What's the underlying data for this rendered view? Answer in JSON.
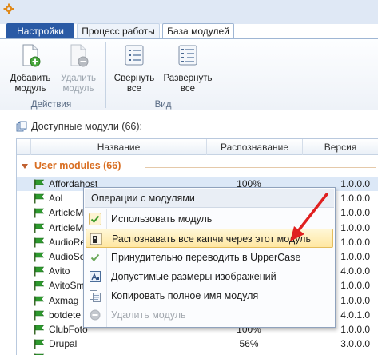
{
  "tabs": [
    {
      "label": "Настройки"
    },
    {
      "label": "Процесс работы"
    },
    {
      "label": "База модулей"
    }
  ],
  "ribbon": {
    "groups": [
      {
        "label": "Действия",
        "buttons": [
          {
            "label_line1": "Добавить",
            "label_line2": "модуль",
            "icon": "add-document-icon",
            "enabled": true
          },
          {
            "label_line1": "Удалить",
            "label_line2": "модуль",
            "icon": "remove-document-icon",
            "enabled": false
          }
        ]
      },
      {
        "label": "Вид",
        "buttons": [
          {
            "label_line1": "Свернуть",
            "label_line2": "все",
            "icon": "collapse-list-icon",
            "enabled": true
          },
          {
            "label_line1": "Развернуть",
            "label_line2": "все",
            "icon": "expand-list-icon",
            "enabled": true
          }
        ]
      }
    ]
  },
  "panel": {
    "title": "Доступные модули (66):"
  },
  "grid": {
    "columns": [
      "Название",
      "Распознавание",
      "Версия"
    ],
    "group_label": "User modules (66)",
    "rows": [
      {
        "name": "Affordahost",
        "recognition": "100%",
        "version": "1.0.0.0",
        "selected": true
      },
      {
        "name": "Aol",
        "recognition": "",
        "version": "1.0.0.0"
      },
      {
        "name": "ArticleM",
        "recognition": "",
        "version": "1.0.0.0"
      },
      {
        "name": "ArticleM",
        "recognition": "",
        "version": "1.0.0.0"
      },
      {
        "name": "AudioRe",
        "recognition": "",
        "version": "1.0.0.0"
      },
      {
        "name": "AudioSo",
        "recognition": "",
        "version": "1.0.0.0"
      },
      {
        "name": "Avito",
        "recognition": "",
        "version": "4.0.0.0"
      },
      {
        "name": "AvitoSm",
        "recognition": "",
        "version": "1.0.0.0"
      },
      {
        "name": "Axmag",
        "recognition": "",
        "version": "1.0.0.0"
      },
      {
        "name": "botdete",
        "recognition": "",
        "version": "4.0.1.0"
      },
      {
        "name": "ClubFoto",
        "recognition": "100%",
        "version": "1.0.0.0"
      },
      {
        "name": "Drupal",
        "recognition": "56%",
        "version": "3.0.0.0"
      },
      {
        "name": "",
        "recognition": "",
        "version": ""
      }
    ]
  },
  "context_menu": {
    "title": "Операции с модулями",
    "items": [
      {
        "label": "Использовать модуль",
        "icon": "check-icon",
        "enabled": true,
        "highlighted": false
      },
      {
        "label": "Распознавать все капчи через этот модуль",
        "icon": "captcha-icon",
        "enabled": true,
        "highlighted": true
      },
      {
        "label": "Принудительно переводить в UpperCase",
        "icon": "check-icon",
        "enabled": true,
        "highlighted": false
      },
      {
        "label": "Допустимые размеры изображений",
        "icon": "image-size-icon",
        "enabled": true,
        "highlighted": false
      },
      {
        "label": "Копировать полное имя модуля",
        "icon": "copy-icon",
        "enabled": true,
        "highlighted": false
      },
      {
        "label": "Удалить модуль",
        "icon": "delete-icon",
        "enabled": false,
        "highlighted": false
      }
    ]
  },
  "colors": {
    "active_tab": "#2a5aa5",
    "group_label": "#d86d20",
    "menu_highlight": "#ffe7a2",
    "annotation_arrow": "#e02020",
    "flag": "#2e9a2e"
  }
}
